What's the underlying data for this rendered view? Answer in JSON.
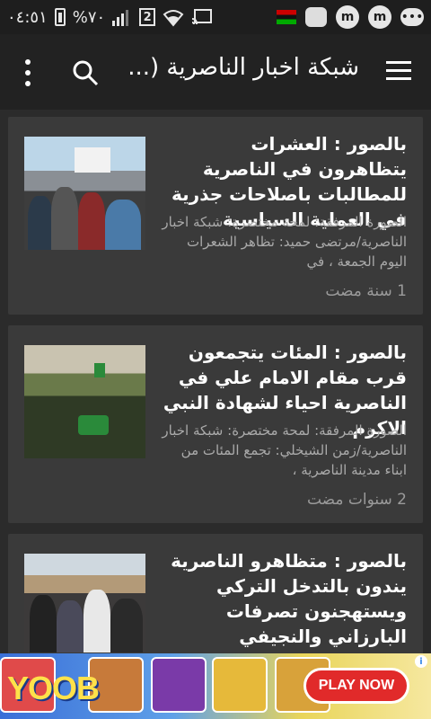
{
  "status_bar": {
    "time": "٠٤:٥١",
    "battery_label": "%٧٠",
    "sim": "2",
    "left_icons": [
      "battery-icon",
      "signal-icon",
      "sim-icon",
      "wifi-icon",
      "cast-icon"
    ],
    "right_icons": [
      "flag-icon",
      "badge-icon",
      "m-app-icon",
      "m-app-icon-2",
      "more-dots-icon"
    ]
  },
  "app_bar": {
    "title": "شبكة اخبار الناصرية (...",
    "menu_icon": "hamburger-icon",
    "search_icon": "search-icon",
    "overflow_icon": "more-vert-icon"
  },
  "articles": [
    {
      "title": "بالصور : العشرات يتظاهرون في الناصرية للمطالبات باصلاحات جذرية في العملية السياسية",
      "excerpt": "الصورة المرفقة: لمحة مختصرة: شبكة اخبار الناصرية/مرتضى حميد: تظاهر الشعرات اليوم الجمعة ، في",
      "time": "1 سنة مضت"
    },
    {
      "title": "بالصور : المئات يتجمعون قرب مقام الامام علي في الناصرية احياء لشهادة النبي الاكرم",
      "excerpt": "الصورة المرفقة: لمحة مختصرة: شبكة اخبار الناصرية/زمن الشيخلي: تجمع المئات من ابناء مدينة الناصرية ،",
      "time": "2 سنوات مضت"
    },
    {
      "title": "بالصور : متظاهرو الناصرية يندون بالتدخل التركي ويستهجنون تصرفات البارزاني والنجيفي",
      "excerpt": "",
      "time": ""
    }
  ],
  "ad": {
    "brand": "YOOB",
    "cta": "PLAY NOW",
    "info": "i"
  },
  "colors": {
    "background": "#2b2b2b",
    "card": "#3a3a3a",
    "app_bar": "#222222",
    "status_bar": "#1e1e1e",
    "ad_cta": "#e12a2a"
  }
}
